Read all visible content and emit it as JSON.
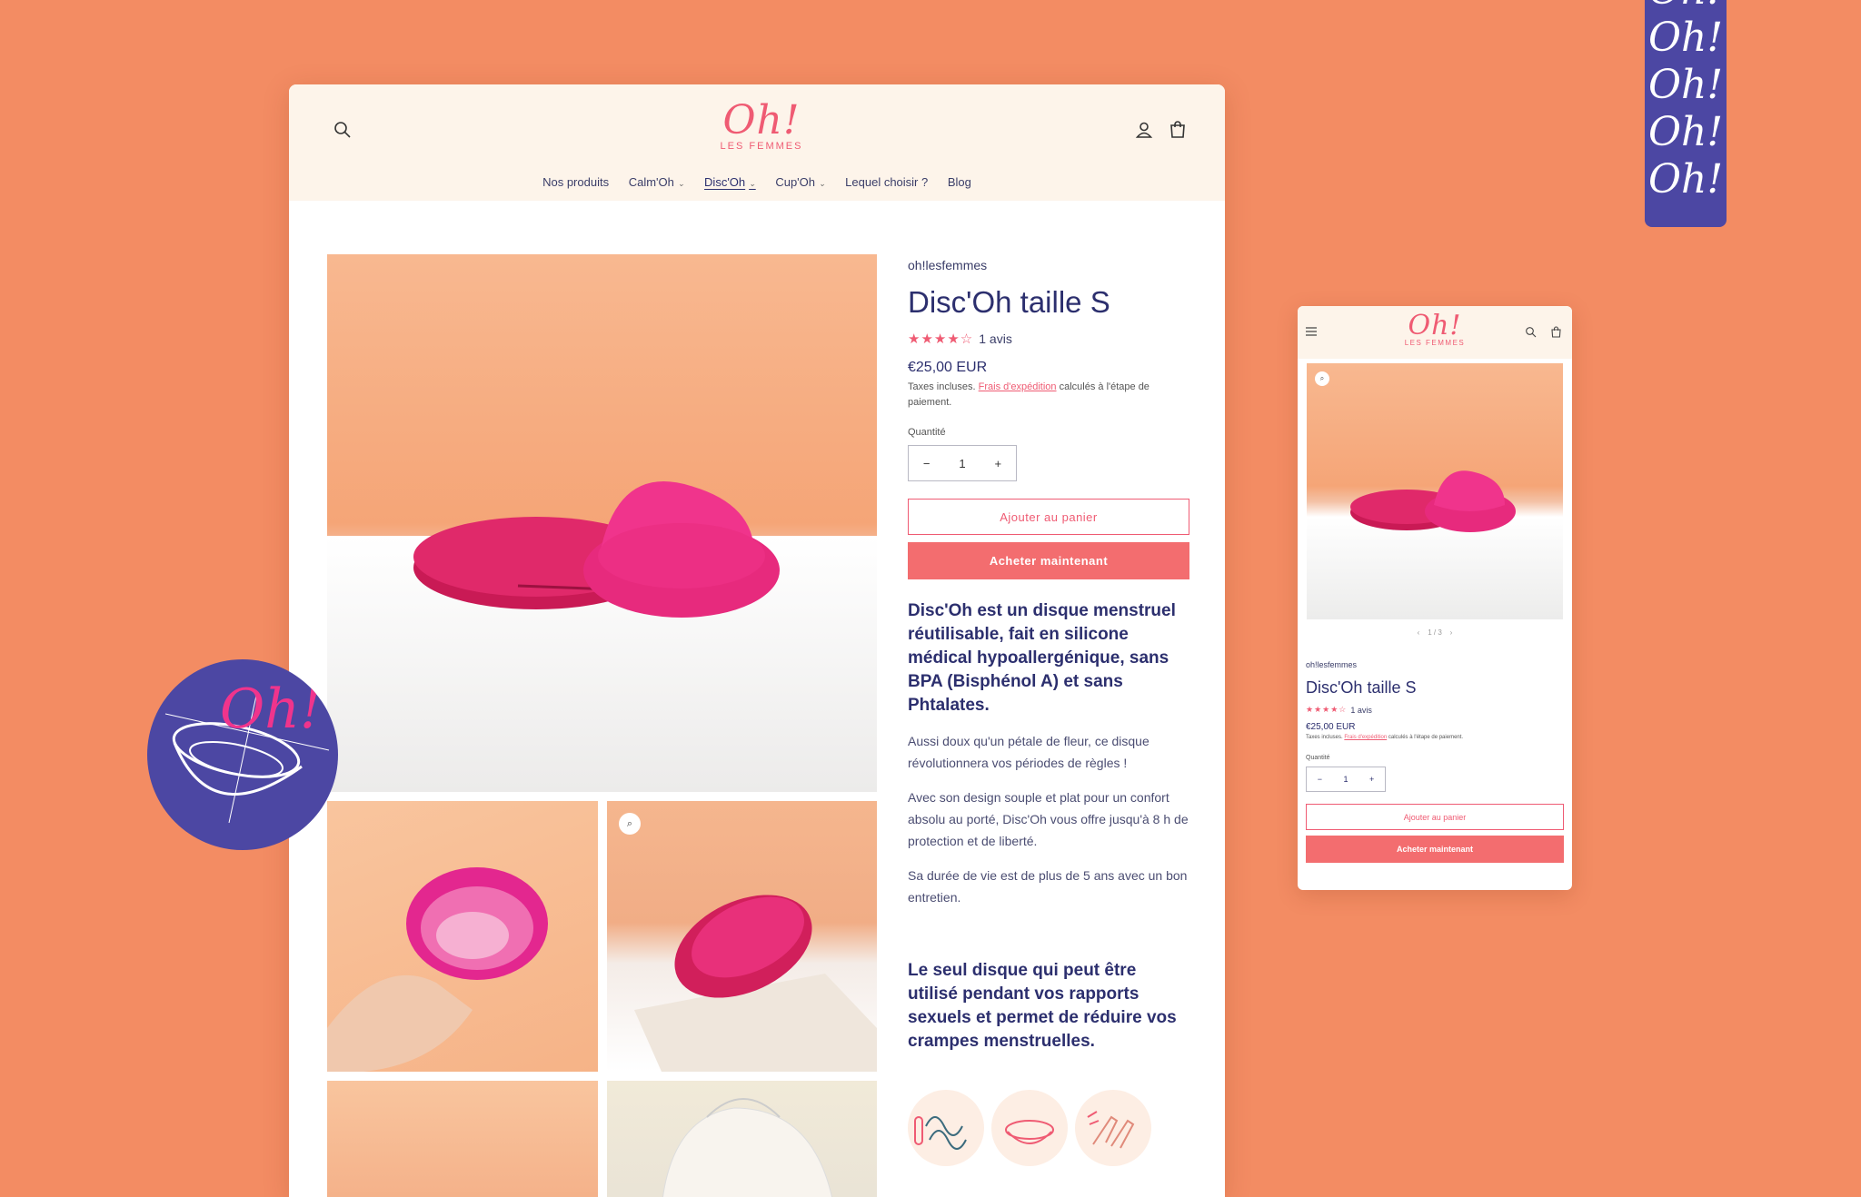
{
  "brand": {
    "logo_mark": "Oh!",
    "logo_sub": "LES FEMMES",
    "pink": "#ef5b73",
    "navy": "#2c2f6e",
    "background": "#f38c63",
    "sticker": "#4c47a3"
  },
  "nav": [
    {
      "label": "Nos produits",
      "has_menu": false,
      "active": false
    },
    {
      "label": "Calm'Oh",
      "has_menu": true,
      "active": false
    },
    {
      "label": "Disc'Oh",
      "has_menu": true,
      "active": true
    },
    {
      "label": "Cup'Oh",
      "has_menu": true,
      "active": false
    },
    {
      "label": "Lequel choisir ?",
      "has_menu": false,
      "active": false
    },
    {
      "label": "Blog",
      "has_menu": false,
      "active": false
    }
  ],
  "icons": {
    "search": "search-icon",
    "account": "account-icon",
    "cart": "cart-icon",
    "menu": "menu-icon",
    "zoom": "zoom-icon"
  },
  "product": {
    "vendor": "oh!lesfemmes",
    "title": "Disc'Oh taille S",
    "stars": "★★★★☆",
    "rating_value": 4,
    "reviews": "1 avis",
    "price": "€25,00 EUR",
    "tax_prefix": "Taxes incluses.",
    "tax_link": "Frais d'expédition",
    "tax_suffix": "calculés à l'étape de paiement.",
    "quantity_label": "Quantité",
    "quantity": "1",
    "minus": "−",
    "plus": "+",
    "add_to_cart": "Ajouter au panier",
    "buy_now": "Acheter maintenant",
    "lead": "Disc'Oh est un disque menstruel réutilisable, fait en silicone médical hypoallergénique, sans BPA (Bisphénol A) et sans Phtalates.",
    "paragraphs": [
      "Aussi doux qu'un pétale de fleur, ce disque révolutionnera vos périodes de règles !",
      "Avec son design souple et plat pour un confort absolu au porté, Disc'Oh vous offre jusqu'à 8 h de protection et de liberté.",
      "Sa durée de vie est de plus de 5 ans avec un bon entretien."
    ],
    "lead2": "Le seul disque qui peut être utilisé pendant vos rapports sexuels et permet de réduire vos crampes menstruelles."
  },
  "mobile": {
    "pager": "1 / 3",
    "prev": "‹",
    "next": "›"
  },
  "stickers": {
    "circle_text": "Oh!",
    "strip_text": "Oh!"
  }
}
